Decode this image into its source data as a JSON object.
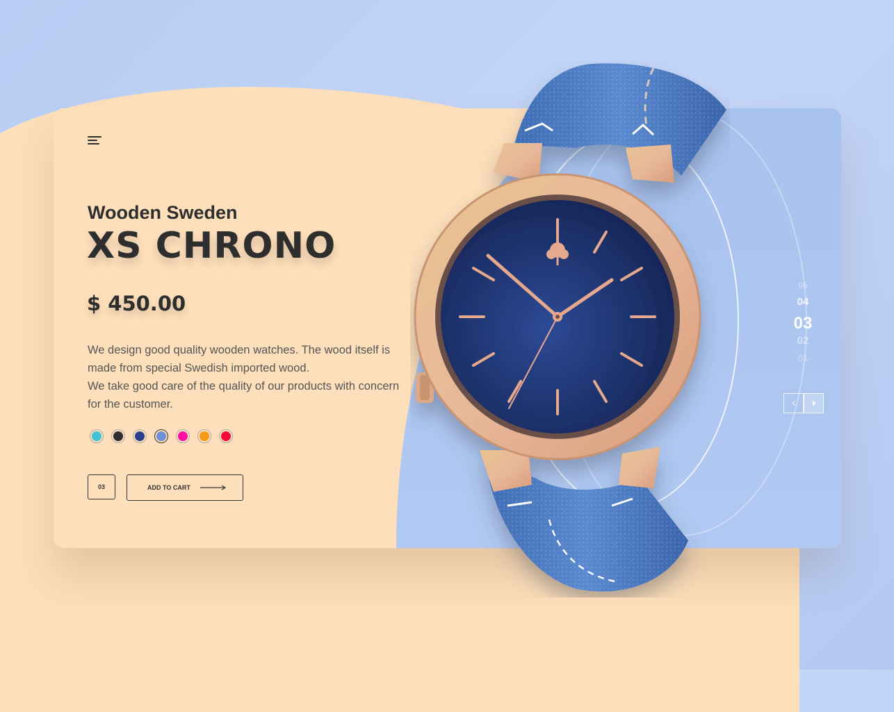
{
  "product": {
    "brand": "Wooden Sweden",
    "name": "XS CHRONO",
    "price": "$ 450.00",
    "description": [
      "We design good quality wooden watches. The wood itself is made from special Swedish imported wood.",
      "We take good care of the quality of our products with concern for the customer."
    ]
  },
  "colors": [
    {
      "hex": "#3fc1d6",
      "selected": false
    },
    {
      "hex": "#2e2e2e",
      "selected": false
    },
    {
      "hex": "#2b3f8c",
      "selected": false
    },
    {
      "hex": "#6f8fd8",
      "selected": true
    },
    {
      "hex": "#ff10a4",
      "selected": false
    },
    {
      "hex": "#f59a1b",
      "selected": false
    },
    {
      "hex": "#f20a3a",
      "selected": false
    }
  ],
  "actions": {
    "quantity": "03",
    "add_to_cart": "ADD TO CART"
  },
  "pager": {
    "items": [
      "05",
      "04",
      "03",
      "02",
      "01"
    ],
    "current": "03"
  },
  "icons": {
    "menu": "menu-icon",
    "arrow": "arrow-right-icon",
    "prev": "chevron-left-icon",
    "next": "chevron-right-icon"
  },
  "theme": {
    "peach": "#fddfbb",
    "blue": "#b1c9f2",
    "text": "#2e2e2e"
  }
}
